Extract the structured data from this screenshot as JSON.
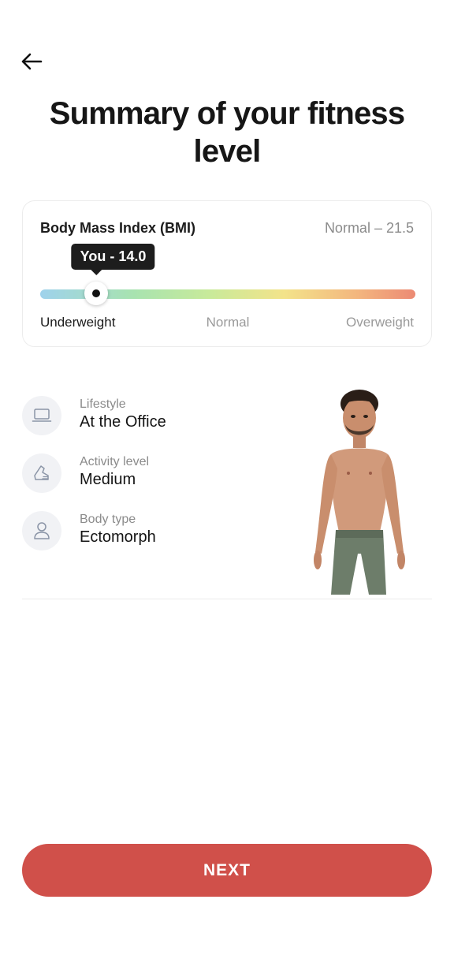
{
  "header": {
    "back_icon": "arrow-left-icon",
    "title": "Summary of your fitness level"
  },
  "bmi": {
    "label": "Body Mass Index (BMI)",
    "normal_text": "Normal – 21.5",
    "tooltip": "You - 14.0",
    "value": 14.0,
    "position_fraction": 0.15,
    "scale": {
      "under": "Underweight",
      "normal": "Normal",
      "over": "Overweight"
    },
    "colors": [
      "#9fd2ec",
      "#a8e3b0",
      "#c8ea9a",
      "#f3e38a",
      "#f3b57e",
      "#ec8a74"
    ]
  },
  "profile": {
    "items": [
      {
        "caption": "Lifestyle",
        "value": "At the Office",
        "icon": "laptop-icon"
      },
      {
        "caption": "Activity level",
        "value": "Medium",
        "icon": "sneaker-icon"
      },
      {
        "caption": "Body type",
        "value": "Ectomorph",
        "icon": "person-icon"
      }
    ]
  },
  "actions": {
    "next_label": "NEXT",
    "next_color": "#d0504a"
  }
}
